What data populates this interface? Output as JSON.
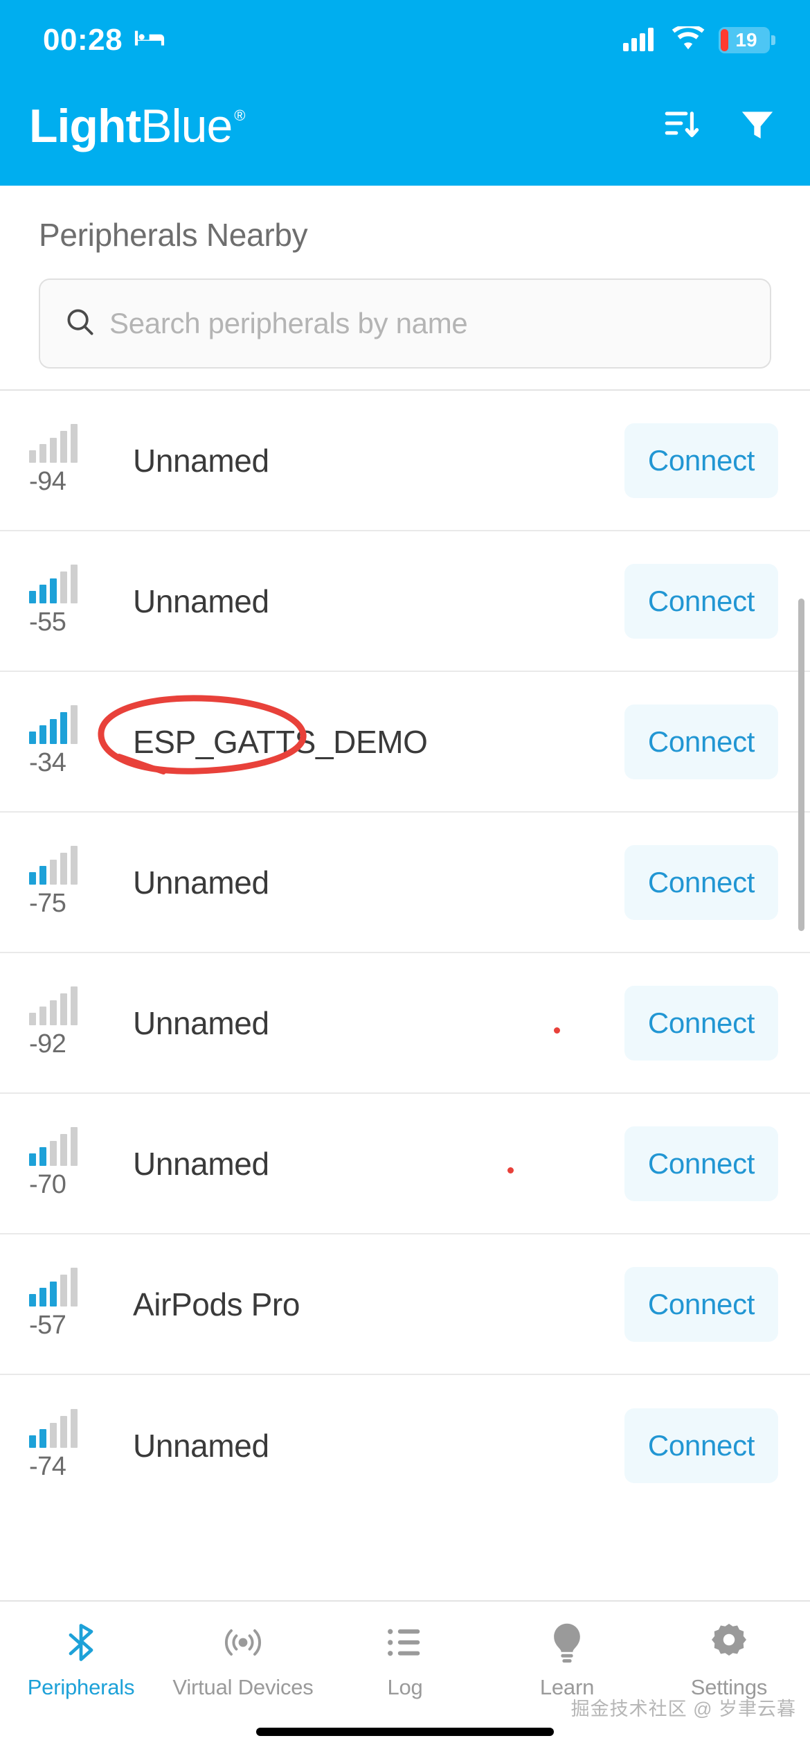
{
  "status_bar": {
    "time": "00:28",
    "sleep_icon": "bed-icon",
    "cellular_icon": "cellular-signal-icon",
    "wifi_icon": "wifi-icon",
    "battery_percent": "19"
  },
  "app_bar": {
    "logo_bold": "Light",
    "logo_light": "Blue",
    "logo_trademark": "®",
    "sort_icon": "sort-descending-icon",
    "filter_icon": "filter-funnel-icon"
  },
  "header": {
    "title": "Peripherals Nearby"
  },
  "search": {
    "icon": "search-icon",
    "placeholder": "Search peripherals by name",
    "value": ""
  },
  "list": {
    "connect_label": "Connect",
    "items": [
      {
        "rssi": "-94",
        "name": "Unnamed",
        "bars_on": 0,
        "highlighted": false
      },
      {
        "rssi": "-55",
        "name": "Unnamed",
        "bars_on": 3,
        "highlighted": false
      },
      {
        "rssi": "-34",
        "name": "ESP_GATTS_DEMO",
        "bars_on": 4,
        "highlighted": true
      },
      {
        "rssi": "-75",
        "name": "Unnamed",
        "bars_on": 2,
        "highlighted": false
      },
      {
        "rssi": "-92",
        "name": "Unnamed",
        "bars_on": 0,
        "highlighted": false
      },
      {
        "rssi": "-70",
        "name": "Unnamed",
        "bars_on": 2,
        "highlighted": false
      },
      {
        "rssi": "-57",
        "name": "AirPods Pro",
        "bars_on": 3,
        "highlighted": false
      },
      {
        "rssi": "-74",
        "name": "Unnamed",
        "bars_on": 2,
        "highlighted": false
      }
    ]
  },
  "tab_bar": {
    "tabs": [
      {
        "label": "Peripherals",
        "icon": "bluetooth-icon",
        "active": true
      },
      {
        "label": "Virtual Devices",
        "icon": "broadcast-icon",
        "active": false
      },
      {
        "label": "Log",
        "icon": "list-icon",
        "active": false
      },
      {
        "label": "Learn",
        "icon": "lightbulb-icon",
        "active": false
      },
      {
        "label": "Settings",
        "icon": "gear-icon",
        "active": false
      }
    ]
  },
  "watermark": {
    "text": "掘金技术社区 @ 岁聿云暮"
  },
  "colors": {
    "brand_blue": "#00AEEF",
    "accent_blue": "#1DA1D8",
    "connect_text": "#2196D3",
    "connect_bg": "#EFF9FD",
    "annotation_red": "#E8413A",
    "battery_red": "#FF3B30"
  }
}
